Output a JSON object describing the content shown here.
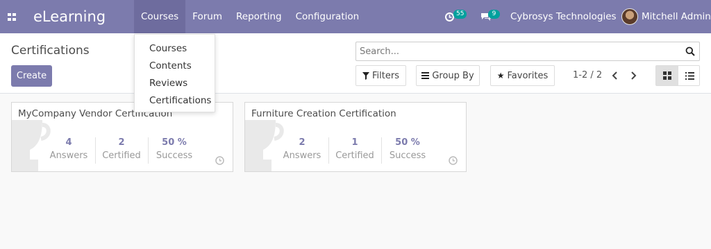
{
  "app": {
    "brand": "eLearning"
  },
  "menu": [
    {
      "label": "Courses",
      "active": true
    },
    {
      "label": "Forum"
    },
    {
      "label": "Reporting"
    },
    {
      "label": "Configuration"
    }
  ],
  "systray": {
    "activity_count": "55",
    "messages_count": "9",
    "company": "Cybrosys Technologies",
    "user": "Mitchell Admin"
  },
  "control": {
    "title": "Certifications",
    "create_label": "Create",
    "search_placeholder": "Search...",
    "filters_label": "Filters",
    "groupby_label": "Group By",
    "favorites_label": "Favorites",
    "pager": "1-2 / 2"
  },
  "dropdown": [
    "Courses",
    "Contents",
    "Reviews",
    "Certifications"
  ],
  "cards": [
    {
      "title": "MyCompany Vendor Certification",
      "answers": "4",
      "answers_label": "Answers",
      "certified": "2",
      "certified_label": "Certified",
      "success": "50 %",
      "success_label": "Success"
    },
    {
      "title": "Furniture Creation Certification",
      "answers": "2",
      "answers_label": "Answers",
      "certified": "1",
      "certified_label": "Certified",
      "success": "50 %",
      "success_label": "Success"
    }
  ],
  "colors": {
    "brand": "#7c7bad",
    "badge": "#00a09d"
  },
  "icons": [
    "apps-icon",
    "activity-icon",
    "chat-icon",
    "search-icon",
    "filter-icon",
    "list-icon",
    "star-icon",
    "chevron-left-icon",
    "chevron-right-icon",
    "kanban-icon",
    "list-view-icon",
    "trophy-icon",
    "clock-icon"
  ]
}
